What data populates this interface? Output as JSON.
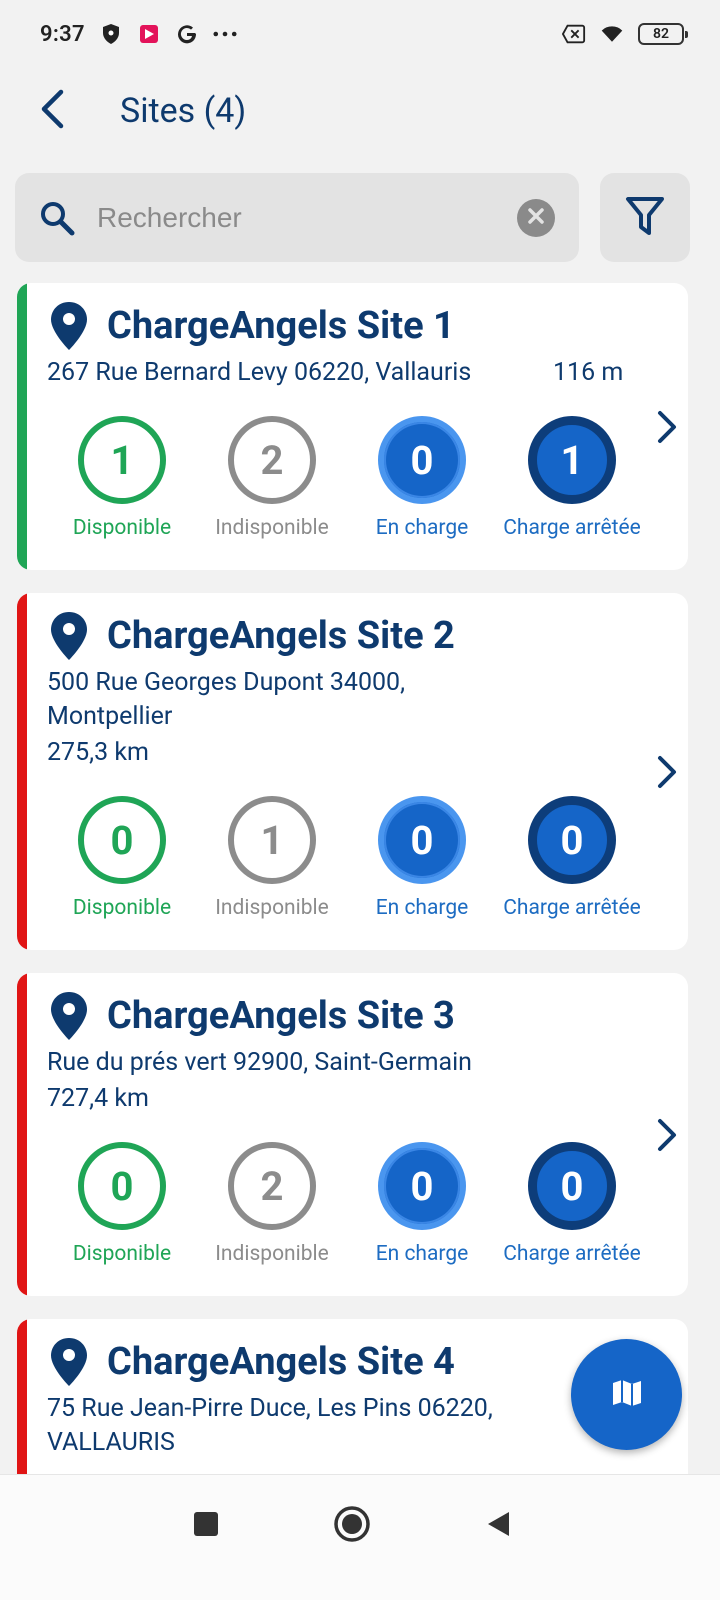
{
  "status_bar": {
    "time": "9:37",
    "battery": "82"
  },
  "header": {
    "title": "Sites (4)"
  },
  "search": {
    "placeholder": "Rechercher",
    "value": ""
  },
  "legend_labels": {
    "available": "Disponible",
    "unavailable": "Indisponible",
    "charging": "En charge",
    "stopped": "Charge arrêtée"
  },
  "colors": {
    "available": "#1fa556",
    "unavailable": "#8c8c8c",
    "charging": "#1565c8",
    "stopped": "#0d3d7a",
    "accent_ok": "#1fa556",
    "accent_error": "#e01515"
  },
  "sites": [
    {
      "name": "ChargeAngels Site 1",
      "address": "267 Rue Bernard Levy 06220, Vallauris",
      "distance": "116 m",
      "available": "1",
      "unavailable": "2",
      "charging": "0",
      "stopped": "1",
      "status_color": "green"
    },
    {
      "name": "ChargeAngels Site 2",
      "address_line1": "500 Rue Georges Dupont 34000,",
      "address_line2": "Montpellier",
      "distance": "275,3 km",
      "available": "0",
      "unavailable": "1",
      "charging": "0",
      "stopped": "0",
      "status_color": "red"
    },
    {
      "name": "ChargeAngels Site 3",
      "address": "Rue du prés vert 92900, Saint-Germain",
      "distance": "727,4 km",
      "available": "0",
      "unavailable": "2",
      "charging": "0",
      "stopped": "0",
      "status_color": "red"
    },
    {
      "name": "ChargeAngels Site 4",
      "address_line1": "75 Rue Jean-Pirre Duce, Les Pins 06220,",
      "address_line2": "VALLAURIS",
      "status_color": "red"
    }
  ],
  "icons": {
    "back": "back-arrow-icon",
    "search": "search-icon",
    "clear": "clear-icon",
    "filter": "filter-icon",
    "pin": "location-pin-icon",
    "chevron": "chevron-right-icon",
    "map": "map-icon"
  }
}
